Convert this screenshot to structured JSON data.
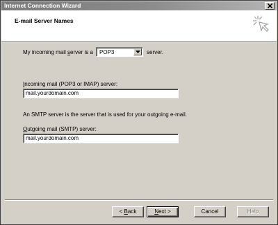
{
  "window": {
    "title": "Internet Connection Wizard"
  },
  "header": {
    "title": "E-mail Server Names"
  },
  "form": {
    "incoming_prefix": "My incoming mail ",
    "incoming_accel": "s",
    "incoming_suffix": "erver is a",
    "server_type": {
      "selected": "POP3"
    },
    "server_word": "server.",
    "incoming_label_accel": "I",
    "incoming_label_rest": "ncoming mail (POP3 or IMAP) server:",
    "incoming_value": "mail.yourdomain.com",
    "smtp_note": "An SMTP server is the server that is used for your outgoing e-mail.",
    "outgoing_label_accel": "O",
    "outgoing_label_rest": "utgoing mail (SMTP) server:",
    "outgoing_value": "mail.yourdomain.com"
  },
  "buttons": {
    "back_prefix": "< ",
    "back_accel": "B",
    "back_rest": "ack",
    "next_accel": "N",
    "next_rest": "ext >",
    "cancel": "Cancel",
    "help": "Help"
  },
  "icons": {
    "close": "close-icon",
    "wizard": "wizard-sparkle-icon",
    "dropdown": "chevron-down-icon"
  },
  "colors": {
    "title_bar_inactive": "#7b7b7b",
    "dialog_face": "#d4d0c8",
    "header_background": "#ffffff"
  }
}
